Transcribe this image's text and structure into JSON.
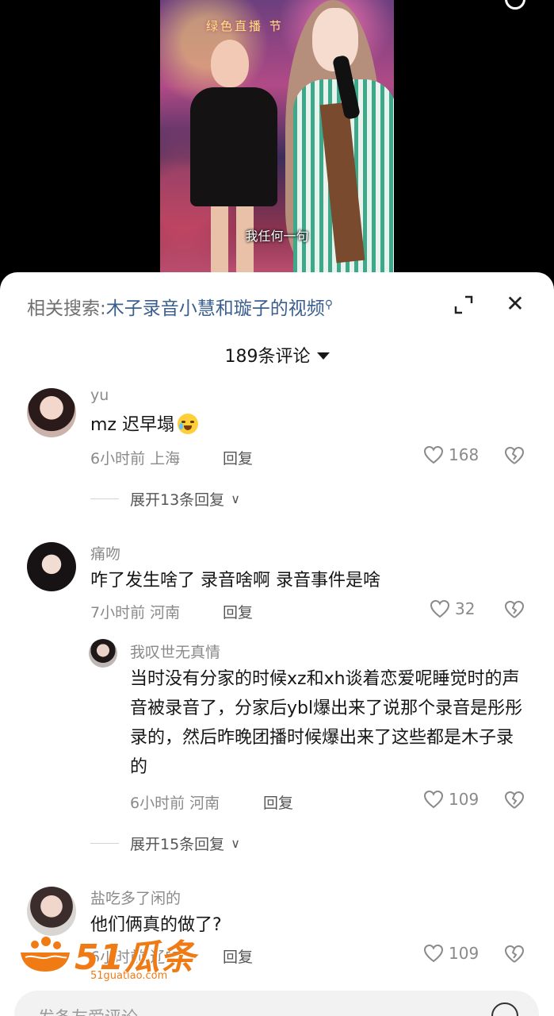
{
  "video": {
    "banner": "绿色直播  节",
    "subtitle": "我任何一句"
  },
  "sheet": {
    "related_prefix": "相关搜索:",
    "related_term": "木子录音小慧和璇子的视频",
    "comment_count": "189条评论"
  },
  "comments": [
    {
      "user": "yu",
      "text": "mz 迟早塌",
      "time": "6小时前",
      "location": "上海",
      "reply_label": "回复",
      "likes": "168",
      "expand_label": "展开13条回复"
    },
    {
      "user": "痛吻",
      "text": "咋了发生啥了 录音啥啊 录音事件是啥",
      "time": "7小时前",
      "location": "河南",
      "reply_label": "回复",
      "likes": "32"
    },
    {
      "user": "盐吃多了闲的",
      "text": "他们俩真的做了?",
      "time": "6小时前",
      "location": "辽宁",
      "reply_label": "回复",
      "likes": "109"
    }
  ],
  "reply": {
    "user": "我叹世无真情",
    "text": "当时没有分家的时候xz和xh谈着恋爱呢睡觉时的声音被录音了，分家后ybl爆出来了说那个录音是彤彤录的，然后昨晚团播时候爆出来了这些都是木子录的",
    "time": "6小时前",
    "location": "河南",
    "reply_label": "回复",
    "likes": "109",
    "expand_label": "展开15条回复"
  },
  "watermark": {
    "brand": "51瓜条",
    "url": "51guatiao.com"
  },
  "input": {
    "placeholder": "发条友爱评论"
  },
  "icons": {
    "expand": "expand-icon",
    "close": "close-icon",
    "like": "heart-icon",
    "dislike": "broken-heart-icon",
    "search": "search-icon",
    "emoji": "emoji-icon"
  }
}
